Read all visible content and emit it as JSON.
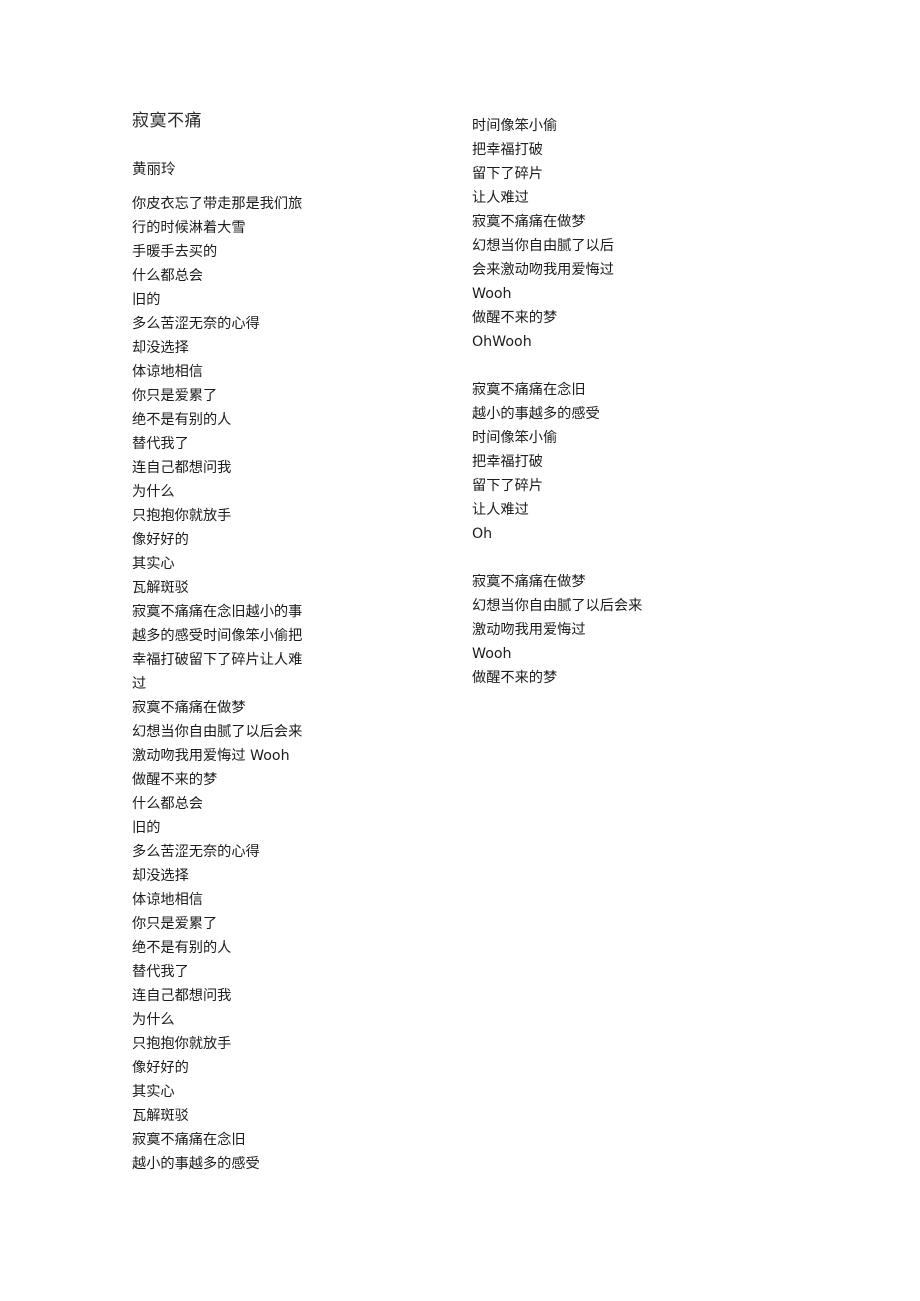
{
  "document": {
    "title": "寂寞不痛",
    "artist": "黄丽玲",
    "background_color": "#ffffff",
    "text_color": "#1c1c1c"
  },
  "columns": {
    "left": {
      "lines": [
        "你皮衣忘了带走那是我们旅行的时候淋着大雪",
        "手暖手去买的",
        "什么都总会",
        "旧的",
        "多么苦涩无奈的心得",
        "却没选择",
        "体谅地相信",
        "你只是爱累了",
        "绝不是有别的人",
        "替代我了",
        "连自己都想问我",
        "为什么",
        "只抱抱你就放手",
        "像好好的",
        "其实心",
        "瓦解斑驳",
        "寂寞不痛痛在念旧越小的事越多的感受时间像笨小偷把幸福打破留下了碎片让人难过",
        "寂寞不痛痛在做梦",
        "幻想当你自由腻了以后会来",
        "激动吻我用爱悔过 Wooh",
        "做醒不来的梦",
        "什么都总会",
        "旧的",
        "多么苦涩无奈的心得",
        "却没选择",
        "体谅地相信",
        "你只是爱累了",
        "绝不是有别的人",
        "替代我了",
        "连自己都想问我",
        "为什么",
        "只抱抱你就放手",
        "像好好的",
        "其实心",
        "瓦解斑驳",
        "寂寞不痛痛在念旧",
        "越小的事越多的感受"
      ]
    },
    "right": {
      "lines": [
        "时间像笨小偷",
        "把幸福打破",
        "留下了碎片",
        "让人难过",
        "寂寞不痛痛在做梦",
        "幻想当你自由腻了以后",
        "会来激动吻我用爱悔过",
        "Wooh",
        "做醒不来的梦",
        "OhWooh",
        "",
        "寂寞不痛痛在念旧",
        "越小的事越多的感受",
        "时间像笨小偷",
        "把幸福打破",
        "留下了碎片",
        "让人难过",
        "Oh",
        "",
        "寂寞不痛痛在做梦",
        "幻想当你自由腻了以后会来",
        "激动吻我用爱悔过",
        "Wooh",
        "做醒不来的梦"
      ]
    }
  }
}
